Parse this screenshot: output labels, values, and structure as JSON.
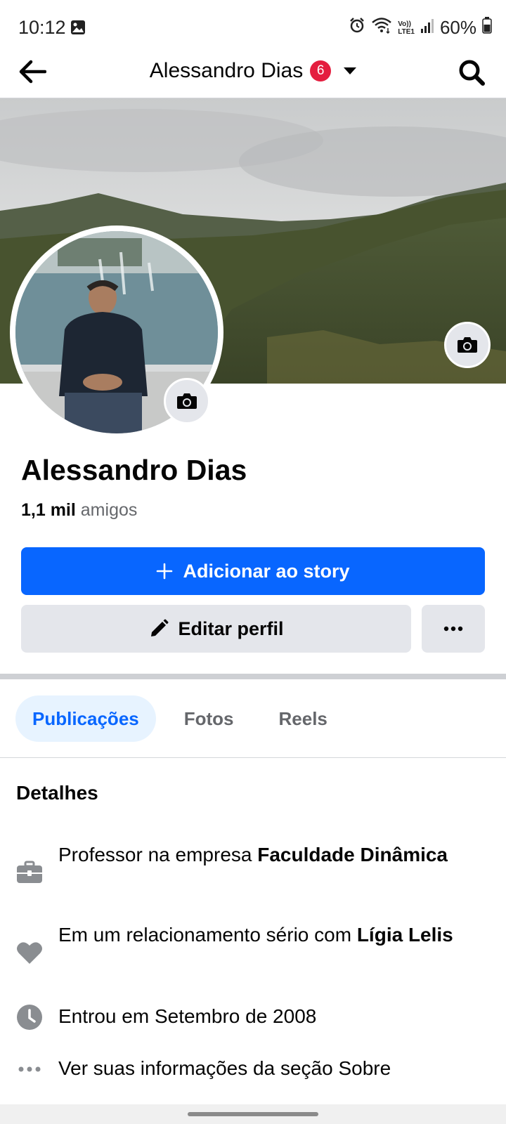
{
  "status_bar": {
    "time": "10:12",
    "battery": "60%",
    "icons": [
      "gallery-icon",
      "alarm-icon",
      "wifi-icon",
      "volte-icon",
      "signal-icon",
      "battery-icon"
    ],
    "volte_text_top": "Vo))",
    "volte_text_bottom": "LTE1"
  },
  "header": {
    "title": "Alessandro Dias",
    "badge": "6"
  },
  "profile": {
    "name": "Alessandro Dias",
    "friends_count": "1,1 mil",
    "friends_label": "amigos"
  },
  "actions": {
    "add_story": "Adicionar ao story",
    "edit_profile": "Editar perfil"
  },
  "tabs": [
    {
      "label": "Publicações",
      "active": true
    },
    {
      "label": "Fotos",
      "active": false
    },
    {
      "label": "Reels",
      "active": false
    }
  ],
  "details": {
    "title": "Detalhes",
    "work": {
      "prefix": "Professor na empresa ",
      "place": "Faculdade Dinâmica"
    },
    "relationship": {
      "prefix": "Em um relacionamento sério com ",
      "person": "Lígia Lelis"
    },
    "joined": "Entrou em Setembro de 2008",
    "about": "Ver suas informações da seção Sobre"
  },
  "colors": {
    "primary": "#0866ff",
    "badge": "#e41e3f",
    "secondary_button": "#e4e6eb",
    "muted_text": "#65676b"
  }
}
